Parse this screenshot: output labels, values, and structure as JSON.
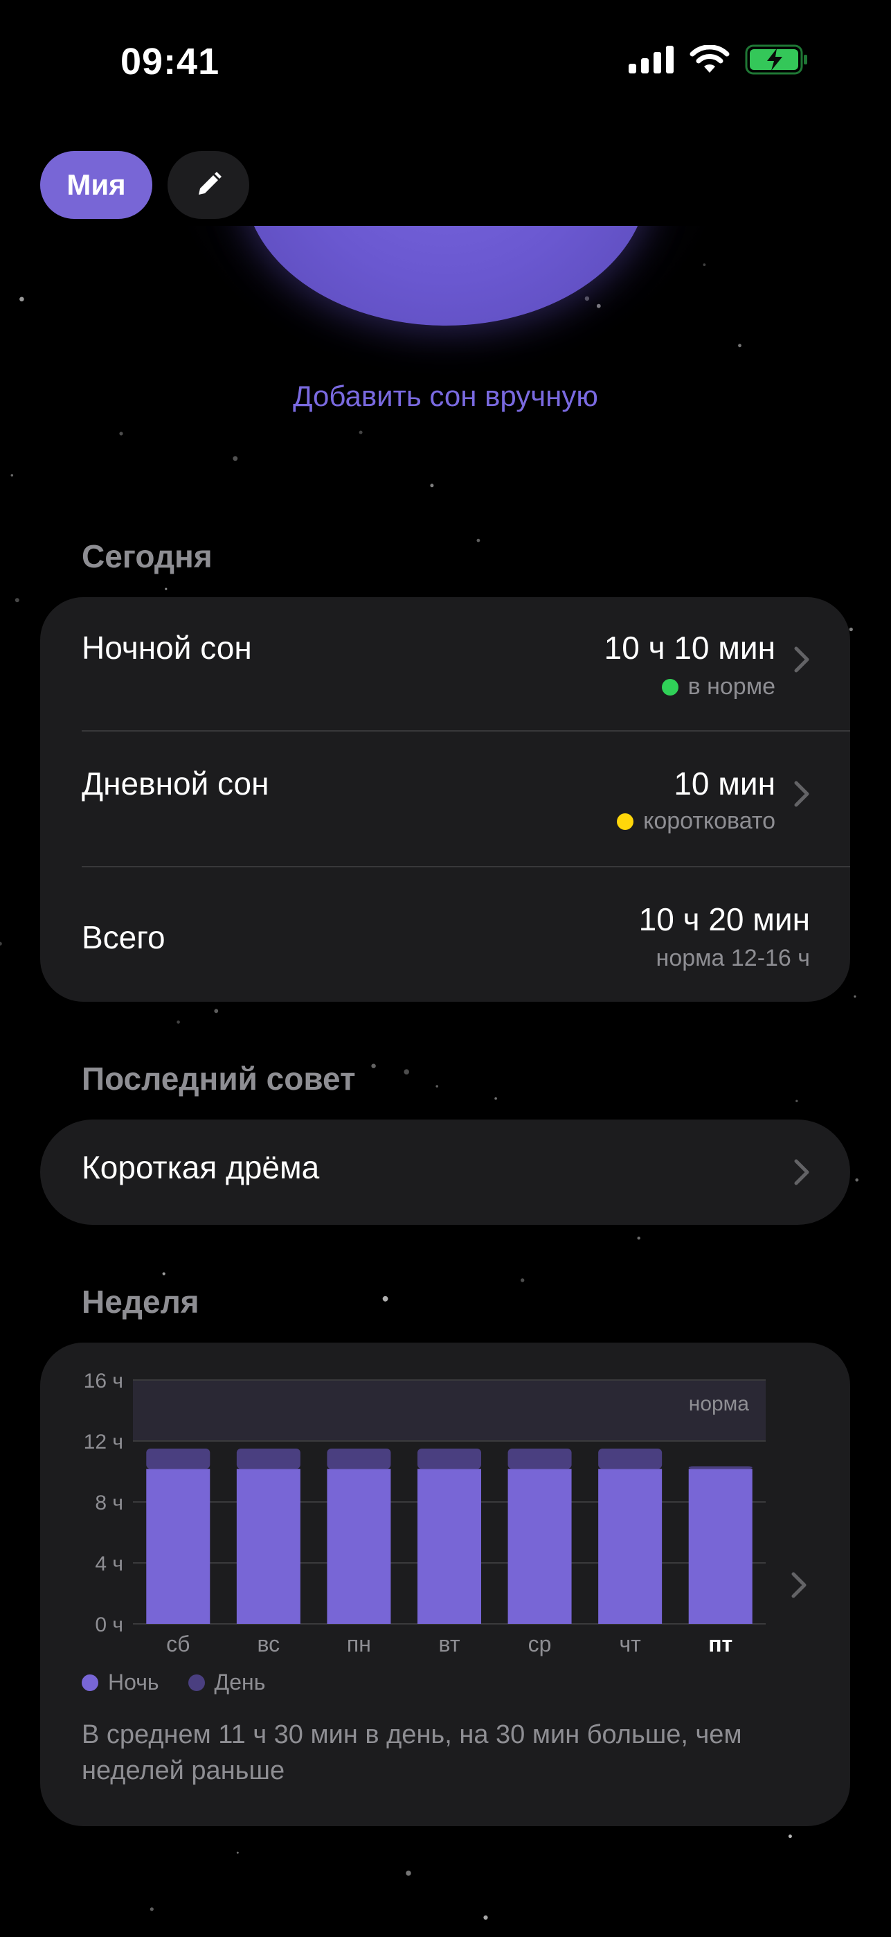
{
  "status_bar": {
    "time": "09:41",
    "icons": [
      "cellular-signal-icon",
      "wifi-icon",
      "battery-charging-icon"
    ],
    "battery_color": "#34c759"
  },
  "header": {
    "profile_name": "Мия",
    "edit_icon": "pencil-icon"
  },
  "add_sleep_link": "Добавить сон вручную",
  "today": {
    "title": "Сегодня",
    "rows": [
      {
        "label": "Ночной сон",
        "value": "10 ч 10 мин",
        "status": "в норме",
        "status_color": "#30d158"
      },
      {
        "label": "Дневной сон",
        "value": "10 мин",
        "status": "коротковато",
        "status_color": "#ffd60a"
      },
      {
        "label": "Всего",
        "value": "10 ч 20 мин",
        "note": "норма 12-16 ч"
      }
    ]
  },
  "last_tip": {
    "title": "Последний совет",
    "item": "Короткая дрёма"
  },
  "week": {
    "title": "Неделя",
    "legend": [
      {
        "label": "Ночь",
        "color": "#7866d6"
      },
      {
        "label": "День",
        "color": "#4a3f80"
      }
    ],
    "summary": "В среднем 11 ч 30 мин в день, на 30 мин больше, чем неделей раньше"
  },
  "chart_data": {
    "type": "bar",
    "stacked": true,
    "categories": [
      "сб",
      "вс",
      "пн",
      "вт",
      "ср",
      "чт",
      "пт"
    ],
    "highlight_category": "пт",
    "series": [
      {
        "name": "Ночь",
        "values": [
          10.17,
          10.17,
          10.17,
          10.17,
          10.17,
          10.17,
          10.17
        ],
        "color": "#7866d6"
      },
      {
        "name": "День",
        "values": [
          1.33,
          1.33,
          1.33,
          1.33,
          1.33,
          1.33,
          0.17
        ],
        "color": "#4a3f80"
      }
    ],
    "y_ticks": [
      "0 ч",
      "4 ч",
      "8 ч",
      "12 ч",
      "16 ч"
    ],
    "ylim": [
      0,
      16
    ],
    "norm_band": {
      "from": 12,
      "to": 16,
      "label": "норма"
    },
    "grid": true
  }
}
